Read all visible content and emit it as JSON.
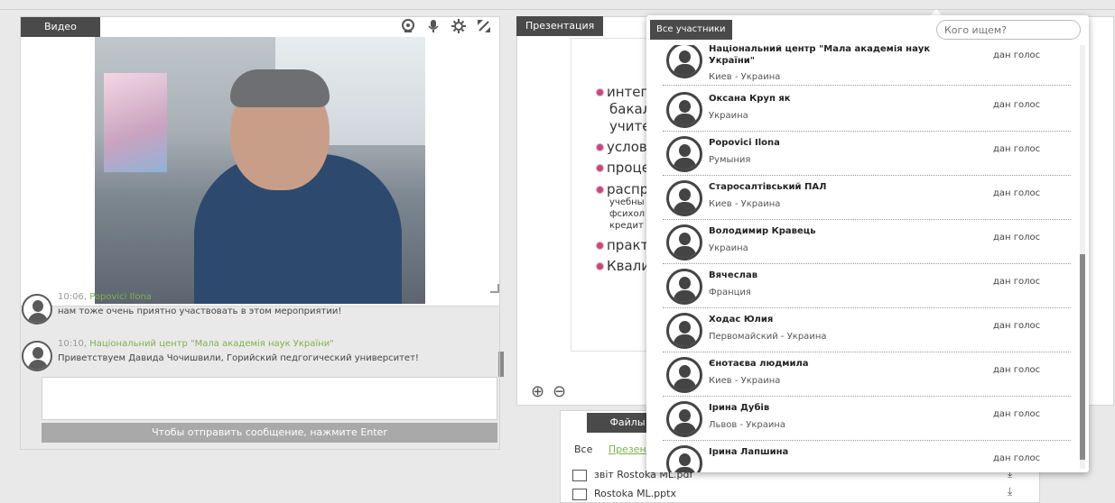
{
  "video": {
    "tab_label": "Видео",
    "tools": [
      "webcam-icon",
      "microphone-icon",
      "gear-icon",
      "expand-icon"
    ]
  },
  "chat": {
    "messages": [
      {
        "time": "10:06,",
        "author": "Popovici Ilona",
        "text": "нам тоже очень приятно участвовать в этом мероприятии!"
      },
      {
        "time": "10:10,",
        "author": "Національний центр \"Мала академія наук України\"",
        "text": "Приветствуем Давида Чочишвили, Горийский педгогический университет!"
      }
    ],
    "send_label": "Чтобы отправить сообщение, нажмите Enter"
  },
  "presentation": {
    "tab_label": "Презентация",
    "bullets": [
      "интег",
      "бакал",
      "учите",
      "услов",
      "проце",
      "распр",
      "учебны",
      "фсихол",
      "кредит",
      "практ",
      "Квали"
    ],
    "zoom_in": "⊕",
    "zoom_out": "⊖"
  },
  "files": {
    "tab_label": "Файлы",
    "filter_all": "Все",
    "filter_pres": "Презен",
    "items": [
      "звіт Rostoka ML.pdf",
      "Rostoka ML.pptx"
    ]
  },
  "participants": {
    "tab_label": "Все участники",
    "search_placeholder": "Кого ищем?",
    "list": [
      {
        "name": "Національний центр \"Мала академія наук України\"",
        "location": "Киев - Украина",
        "status": "дан голос"
      },
      {
        "name": "Оксана Круп як",
        "location": "Украина",
        "status": "дан голос"
      },
      {
        "name": "Popovici Ilona",
        "location": "Румыния",
        "status": "дан голос"
      },
      {
        "name": "Старосалтівський ПАЛ",
        "location": "Киев - Украина",
        "status": "дан голос"
      },
      {
        "name": "Володимир Кравець",
        "location": "Украина",
        "status": "дан голос"
      },
      {
        "name": "Вячеслав",
        "location": "Франция",
        "status": "дан голос"
      },
      {
        "name": "Ходас Юлия",
        "location": "Первомайский - Украина",
        "status": "дан голос"
      },
      {
        "name": "Єнотаєва людмила",
        "location": "Киев - Украина",
        "status": "дан голос"
      },
      {
        "name": "Ірина Дубів",
        "location": "Львов - Украина",
        "status": "дан голос"
      },
      {
        "name": "Ірина Лапшина",
        "location": "",
        "status": "дан голос"
      }
    ]
  }
}
